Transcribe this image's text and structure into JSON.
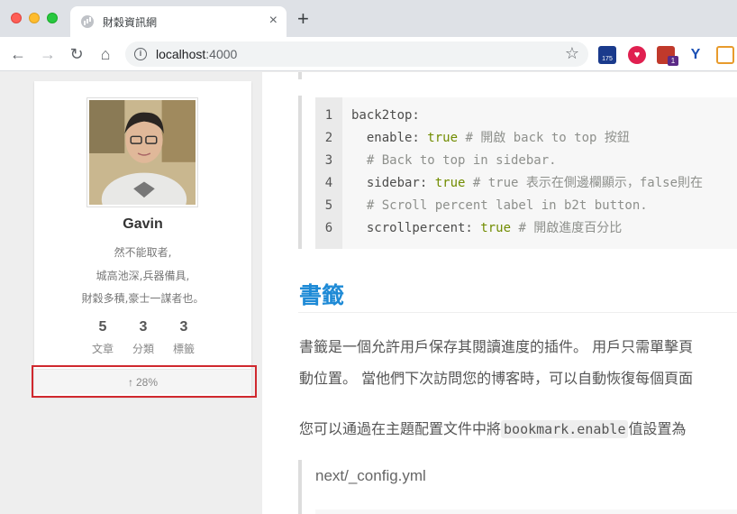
{
  "browser": {
    "tab_title": "財穀資訊網",
    "tab_close": "×",
    "new_tab": "+",
    "url_host": "localhost",
    "url_port": ":4000",
    "icons": [
      "back-arrow-icon",
      "forward-arrow-icon",
      "reload-icon",
      "home-icon",
      "info-icon",
      "star-icon"
    ],
    "extensions": [
      {
        "name": "calendar-extension-icon",
        "badge": "175"
      },
      {
        "name": "heart-extension-icon"
      },
      {
        "name": "translate-extension-icon",
        "badge": "1"
      },
      {
        "name": "y-extension-icon"
      },
      {
        "name": "picture-extension-icon"
      }
    ]
  },
  "sidebar": {
    "author": "Gavin",
    "motto_lines": [
      "然不能取者,",
      "城高池深,兵器備具,",
      "財穀多積,豪士一謀者也。"
    ],
    "stats": [
      {
        "count": "5",
        "label": "文章"
      },
      {
        "count": "3",
        "label": "分類"
      },
      {
        "count": "3",
        "label": "標籤"
      }
    ],
    "back_to_top": {
      "arrow": "↑",
      "percent": "28%"
    }
  },
  "content": {
    "code_lines": [
      {
        "n": "1",
        "parts": [
          {
            "t": "back2top:",
            "c": ""
          }
        ]
      },
      {
        "n": "2",
        "parts": [
          {
            "t": "  enable: ",
            "c": ""
          },
          {
            "t": "true",
            "c": "kw"
          },
          {
            "t": " # 開啟 back to top 按鈕",
            "c": "cm"
          }
        ]
      },
      {
        "n": "3",
        "parts": [
          {
            "t": "  # Back to top in sidebar.",
            "c": "cm"
          }
        ]
      },
      {
        "n": "4",
        "parts": [
          {
            "t": "  sidebar: ",
            "c": ""
          },
          {
            "t": "true",
            "c": "kw"
          },
          {
            "t": " # true 表示在側邊欄顯示，false則在",
            "c": "cm"
          }
        ]
      },
      {
        "n": "5",
        "parts": [
          {
            "t": "  # Scroll percent label in b2t button.",
            "c": "cm"
          }
        ]
      },
      {
        "n": "6",
        "parts": [
          {
            "t": "  scrollpercent: ",
            "c": ""
          },
          {
            "t": "true",
            "c": "kw"
          },
          {
            "t": " # 開啟進度百分比",
            "c": "cm"
          }
        ]
      }
    ],
    "heading": "書籤",
    "para1": "書籤是一個允許用戶保存其閱讀進度的插件。 用戶只需單擊頁",
    "para2": "動位置。 當他們下次訪問您的博客時，可以自動恢復每個頁面",
    "para3_before": "您可以通過在主題配置文件中將",
    "para3_code": "bookmark.enable",
    "para3_after": "值設置為",
    "quote": "next/_config.yml"
  }
}
